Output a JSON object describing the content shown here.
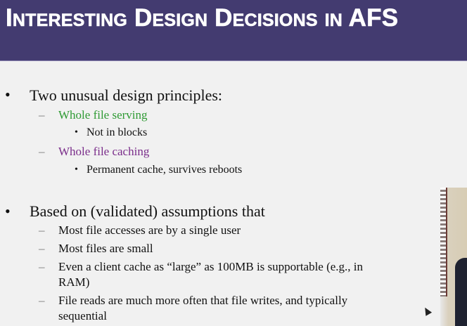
{
  "slide": {
    "title": "Interesting Design Decisions in AFS",
    "header_color": "#433b70",
    "bullets": [
      {
        "text": "Two unusual design principles:",
        "children": [
          {
            "text": "Whole file serving",
            "color": "#2e9a33",
            "children": [
              {
                "text": "Not in blocks"
              }
            ]
          },
          {
            "text": "Whole file caching",
            "color": "#7a2d8a",
            "children": [
              {
                "text": "Permanent cache, survives reboots"
              }
            ]
          }
        ]
      },
      {
        "text": "Based on (validated) assumptions that",
        "children": [
          {
            "text": "Most file accesses are by a single user"
          },
          {
            "text": "Most files are small"
          },
          {
            "text": "Even a client cache as “large” as 100MB is supportable (e.g., in",
            "cont": "RAM)"
          },
          {
            "text": "File reads are much more often that file writes, and typically",
            "cont": "sequential"
          }
        ]
      }
    ],
    "bullet_glyph": "•",
    "dash_glyph": "–"
  }
}
